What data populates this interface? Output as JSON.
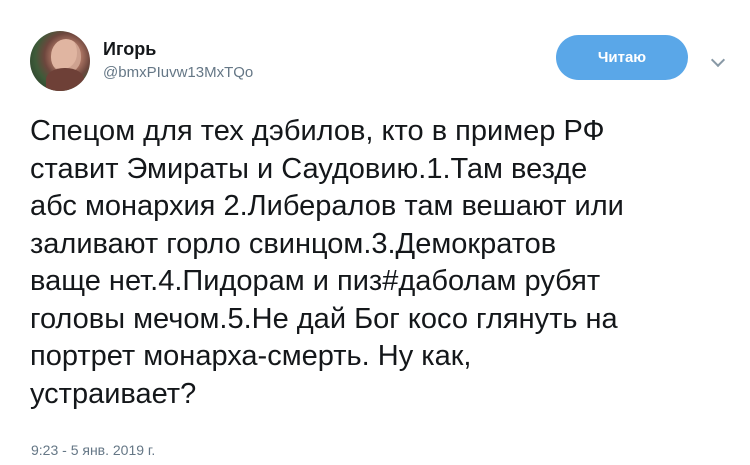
{
  "tweet": {
    "user": {
      "name": "Игорь",
      "handle": "@bmxPIuvw13MxTQo"
    },
    "follow_button": {
      "label": "Читаю"
    },
    "text": "Спецом для тех дэбилов, кто в пример РФ\nставит Эмираты и Саудовию.1.Там везде\nабс монархия 2.Либералов там вешают или\nзаливают горло свинцом.3.Демократов\nваще нет.4.Пидорам и пиз#даболам рубят\nголовы мечом.5.Не дай Бог косо глянуть на\nпортрет монарха-смерть. Ну как,\nустраивает?",
    "timestamp": "9:23 - 5 янв. 2019 г."
  },
  "colors": {
    "accent": "#5aa7e8",
    "secondary_text": "#657786",
    "primary_text": "#14171a"
  },
  "icons": {
    "menu": "chevron-down-icon",
    "avatar": "avatar"
  }
}
